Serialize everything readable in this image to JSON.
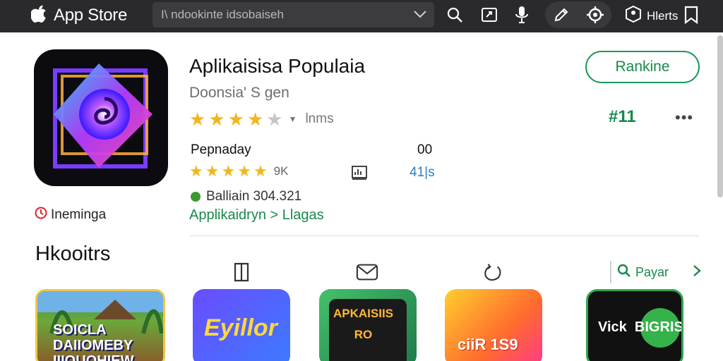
{
  "topbar": {
    "brand_label": "App Store",
    "brand_icon": "apple-logo-icon",
    "search_text": "I\\ ndookinte idsobaiseh",
    "user_label": "Hlerts",
    "icons": [
      "search-icon",
      "screen-icon",
      "microphone-icon",
      "pen-icon",
      "settings-icon",
      "user-icon",
      "bookmark-icon"
    ]
  },
  "app": {
    "title": "Aplikaisisa Populaia",
    "developer": "Doonsia' S gen",
    "rating_stars": 4,
    "rating_text": "lnms",
    "install_label": "Rankine",
    "rank": "#11",
    "more_label": "•••"
  },
  "stats": {
    "section_label": "Pepnaday",
    "section_value": "00",
    "stars_count": 5,
    "count_label": "9K",
    "size_value": "41|s",
    "status_text": "Balliain 304.321",
    "tagline": "Applikaidryn > Llagas"
  },
  "notice": {
    "text": "Ineminga"
  },
  "section": {
    "title": "Hkooitrs",
    "see_all_label": "Payar",
    "tiles": [
      {
        "text": "SOICLA\nDAIIOMEBY\nIIIOUOHIEW"
      },
      {
        "text": "Eyillor"
      },
      {
        "text": "APKAISIIS\nRO"
      },
      {
        "text": "ciiR 1S9"
      },
      {
        "text": "Vick  BIGRIS"
      }
    ]
  },
  "colors": {
    "topbar_bg": "#2a2a2c",
    "accent_green": "#17894b",
    "star_yellow": "#f2b51c",
    "link_blue": "#2a7fbf"
  }
}
